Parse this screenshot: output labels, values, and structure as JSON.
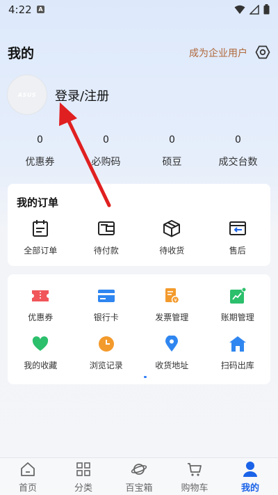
{
  "status_bar": {
    "time": "4:22",
    "badge": "A"
  },
  "header": {
    "title": "我的",
    "enterprise_link": "成为企业用户"
  },
  "profile": {
    "avatar_text": "ASUS",
    "login_label": "登录/注册"
  },
  "stats": [
    {
      "value": "0",
      "label": "优惠券"
    },
    {
      "value": "0",
      "label": "必购码"
    },
    {
      "value": "0",
      "label": "硕豆"
    },
    {
      "value": "0",
      "label": "成交台数"
    }
  ],
  "orders": {
    "title": "我的订单",
    "items": [
      {
        "label": "全部订单",
        "icon": "calendar-icon"
      },
      {
        "label": "待付款",
        "icon": "wallet-icon"
      },
      {
        "label": "待收货",
        "icon": "box-icon"
      },
      {
        "label": "售后",
        "icon": "return-icon"
      }
    ]
  },
  "services": [
    {
      "label": "优惠券",
      "icon": "coupon-icon",
      "color": "#f0565a"
    },
    {
      "label": "银行卡",
      "icon": "bank-card-icon",
      "color": "#2f86f0"
    },
    {
      "label": "发票管理",
      "icon": "invoice-icon",
      "color": "#f39a2c"
    },
    {
      "label": "账期管理",
      "icon": "chart-icon",
      "color": "#2cbf6c"
    },
    {
      "label": "我的收藏",
      "icon": "heart-icon",
      "color": "#2cbf6c"
    },
    {
      "label": "浏览记录",
      "icon": "clock-icon",
      "color": "#f39a2c"
    },
    {
      "label": "收货地址",
      "icon": "location-icon",
      "color": "#2f86f0"
    },
    {
      "label": "扫码出库",
      "icon": "warehouse-icon",
      "color": "#2f86f0"
    }
  ],
  "tabbar": [
    {
      "label": "首页",
      "icon": "home-icon"
    },
    {
      "label": "分类",
      "icon": "grid-icon"
    },
    {
      "label": "百宝箱",
      "icon": "planet-icon"
    },
    {
      "label": "购物车",
      "icon": "cart-icon"
    },
    {
      "label": "我的",
      "icon": "user-icon",
      "active": true
    }
  ],
  "colors": {
    "accent": "#1a63e8",
    "enterprise": "#b0683a",
    "arrow": "#e02020"
  }
}
